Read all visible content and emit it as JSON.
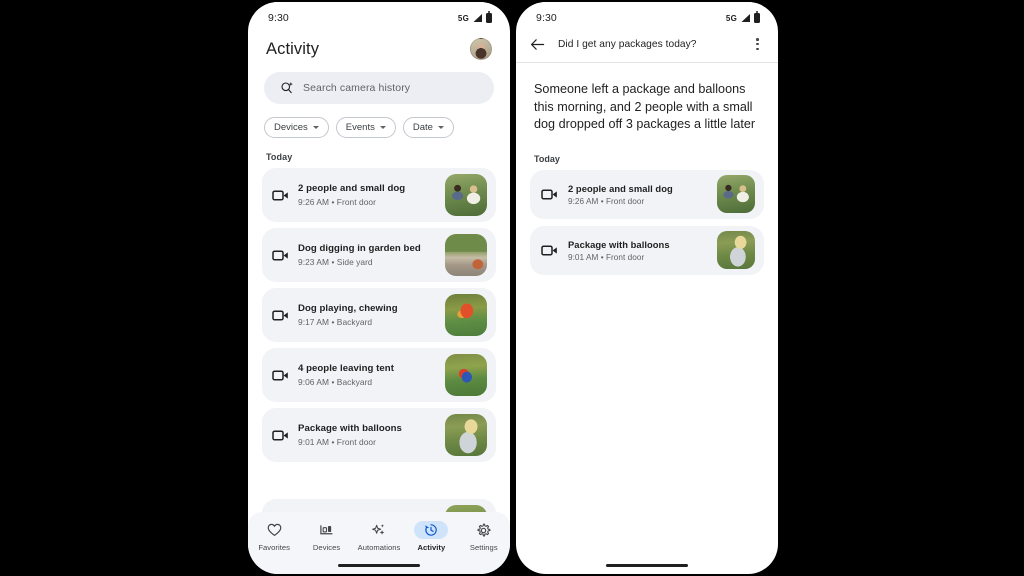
{
  "theme": {
    "background": "#000000",
    "surface": "#ffffff",
    "card": "#f1f3f7",
    "search_field": "#eceef4",
    "accent": "#cfe4fb",
    "text_primary": "#1f1f1f",
    "text_secondary": "#5f6368",
    "nav_bar": "#f4f6fa"
  },
  "left_phone": {
    "status_bar": {
      "time": "9:30",
      "network": "5G",
      "signal_icon": "signal-bars-icon",
      "battery_icon": "battery-icon"
    },
    "header": {
      "title": "Activity",
      "avatar_icon": "profile-avatar"
    },
    "search": {
      "placeholder": "Search camera history",
      "icon": "search-sparkle-icon"
    },
    "filters": [
      {
        "label": "Devices",
        "icon": "chevron-down-icon"
      },
      {
        "label": "Events",
        "icon": "chevron-down-icon"
      },
      {
        "label": "Date",
        "icon": "chevron-down-icon"
      }
    ],
    "section_label": "Today",
    "events": [
      {
        "title": "2 people and small dog",
        "time": "9:26 AM",
        "location": "Front door",
        "meta": "9:26 AM • Front door",
        "icon": "video-camera-icon",
        "thumb": "th-people"
      },
      {
        "title": "Dog digging in garden bed",
        "time": "9:23 AM",
        "location": "Side yard",
        "meta": "9:23 AM • Side yard",
        "icon": "video-camera-icon",
        "thumb": "th-garden"
      },
      {
        "title": "Dog playing, chewing",
        "time": "9:17 AM",
        "location": "Backyard",
        "meta": "9:17 AM • Backyard",
        "icon": "video-camera-icon",
        "thumb": "th-dog"
      },
      {
        "title": "4 people leaving tent",
        "time": "9:06 AM",
        "location": "Backyard",
        "meta": "9:06 AM • Backyard",
        "icon": "video-camera-icon",
        "thumb": "th-tent"
      },
      {
        "title": "Package with balloons",
        "time": "9:01 AM",
        "location": "Front door",
        "meta": "9:01 AM • Front door",
        "icon": "video-camera-icon",
        "thumb": "th-package"
      }
    ],
    "bottom_nav": {
      "active": "Activity",
      "items": [
        {
          "label": "Favorites",
          "icon": "heart-icon"
        },
        {
          "label": "Devices",
          "icon": "devices-icon"
        },
        {
          "label": "Automations",
          "icon": "sparkle-icon"
        },
        {
          "label": "Activity",
          "icon": "history-clock-icon"
        },
        {
          "label": "Settings",
          "icon": "gear-icon"
        }
      ]
    }
  },
  "right_phone": {
    "status_bar": {
      "time": "9:30",
      "network": "5G",
      "signal_icon": "signal-bars-icon",
      "battery_icon": "battery-icon"
    },
    "header": {
      "back_icon": "back-arrow-icon",
      "query": "Did I get any packages today?",
      "overflow_icon": "more-vertical-icon"
    },
    "summary": "Someone left a package and balloons this morning, and 2 people with a small dog dropped off 3 packages a little later",
    "section_label": "Today",
    "events": [
      {
        "title": "2 people and small dog",
        "time": "9:26 AM",
        "location": "Front door",
        "meta": "9:26 AM • Front door",
        "icon": "video-camera-icon",
        "thumb": "th-people"
      },
      {
        "title": "Package with balloons",
        "time": "9:01 AM",
        "location": "Front door",
        "meta": "9:01 AM • Front door",
        "icon": "video-camera-icon",
        "thumb": "th-package"
      }
    ]
  }
}
